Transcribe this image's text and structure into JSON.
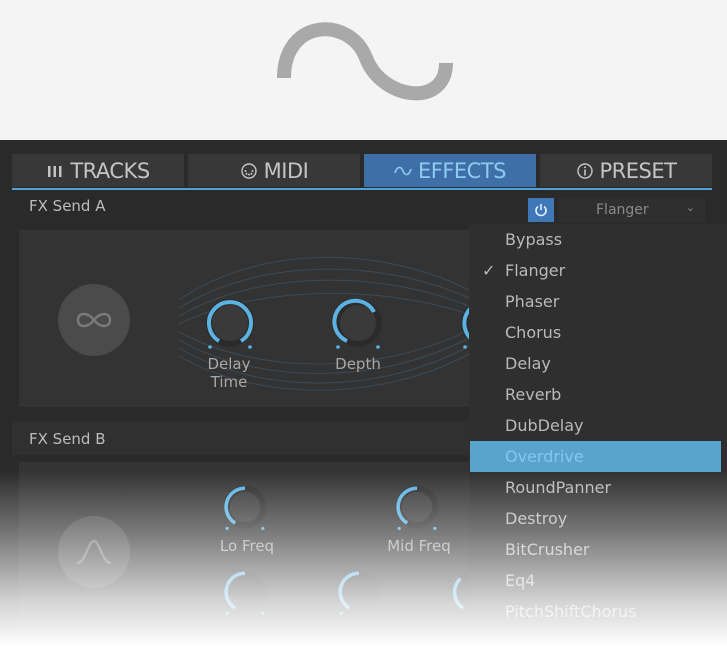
{
  "tabs": [
    {
      "label": "TRACKS",
      "icon": "bars-icon"
    },
    {
      "label": "MIDI",
      "icon": "midi-port-icon"
    },
    {
      "label": "EFFECTS",
      "icon": "sine-wave-icon"
    },
    {
      "label": "PRESET",
      "icon": "info-icon"
    }
  ],
  "active_tab": "EFFECTS",
  "send_a": {
    "label": "FX Send A",
    "selected_effect": "Flanger",
    "power_on": true,
    "symbol": "infinity-icon",
    "knobs": [
      {
        "label_line1": "Delay",
        "label_line2": "Time"
      },
      {
        "label_line1": "Depth",
        "label_line2": ""
      }
    ]
  },
  "send_b": {
    "label": "FX Send B",
    "symbol": "bell-curve-icon",
    "knobs": [
      {
        "label": "Lo Freq"
      },
      {
        "label": "Mid Freq"
      }
    ]
  },
  "dropdown": {
    "items": [
      "Bypass",
      "Flanger",
      "Phaser",
      "Chorus",
      "Delay",
      "Reverb",
      "DubDelay",
      "Overdrive",
      "RoundPanner",
      "Destroy",
      "BitCrusher",
      "Eq4",
      "PitchShiftChorus"
    ],
    "checked": "Flanger",
    "highlighted": "Overdrive"
  },
  "colors": {
    "accent": "#4fa3d8",
    "active_tab_bg": "#3e6fa6",
    "highlight_bg": "#5aa3cc",
    "panel_bg": "#333333",
    "app_bg": "#2a2a2a"
  }
}
